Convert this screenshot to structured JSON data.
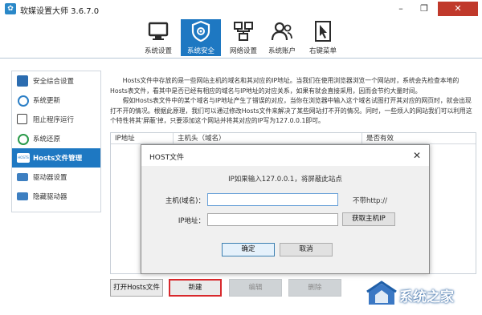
{
  "window": {
    "title": "软媒设置大师 3.6.7.0",
    "controls": {
      "minimize": "–",
      "maximize": "❐",
      "close": "✕"
    }
  },
  "toolbar": {
    "items": [
      {
        "label": "系统设置",
        "icon": "computer-icon",
        "active": false
      },
      {
        "label": "系统安全",
        "icon": "shield-icon",
        "active": true
      },
      {
        "label": "网络设置",
        "icon": "network-icon",
        "active": false
      },
      {
        "label": "系统账户",
        "icon": "users-icon",
        "active": false
      },
      {
        "label": "右键菜单",
        "icon": "cursor-icon",
        "active": false
      }
    ]
  },
  "sidebar": {
    "items": [
      {
        "label": "安全综合设置",
        "icon": "shield-icon",
        "active": false
      },
      {
        "label": "系统更新",
        "icon": "refresh-icon",
        "active": false
      },
      {
        "label": "阻止程序运行",
        "icon": "block-icon",
        "active": false
      },
      {
        "label": "系统还原",
        "icon": "restore-icon",
        "active": false
      },
      {
        "label": "Hosts文件管理",
        "icon": "hosts-icon",
        "active": true
      },
      {
        "label": "驱动器设置",
        "icon": "drive-icon",
        "active": false
      },
      {
        "label": "隐藏驱动器",
        "icon": "hidden-drive-icon",
        "active": false
      }
    ]
  },
  "description": {
    "p1": "Hosts文件中存放的是一些网站主机的域名和其对应的IP地址。当我们在使用浏览器浏览一个网站时，系统会先检查本地的Hosts表文件，看其中是否已经有相应的域名与IP地址的对应关系，如果有就会直接采用，因而会节约大量时间。",
    "p2": "假如Hosts表文件中的某个域名与IP地址产生了错误的对应，当你在浏览器中输入这个域名试图打开其对应的网页时，就会出现打不开的情况。根据此原理，我们可以通过修改Hosts文件来解决了某些网站打不开的情况。同时，一些烦人的网站我们可以利用这个特性将其'屏蔽'掉，只要添加这个网站并将其对应的IP写为127.0.0.1即可。"
  },
  "table": {
    "columns": [
      "IP地址",
      "主机头（域名）",
      "是否有效"
    ]
  },
  "dialog": {
    "title": "HOST文件",
    "close": "✕",
    "hint": "IP如果输入127.0.0.1，将屏蔽此站点",
    "host_label": "主机(域名)：",
    "host_value": "",
    "host_note": "不带http://",
    "ip_label": "IP地址：",
    "ip_value": "",
    "fetch_button": "获取主机IP",
    "ok_button": "确定",
    "cancel_button": "取消"
  },
  "buttons": {
    "open_hosts": "打开Hosts文件",
    "new": "新建",
    "edit": "编辑",
    "delete": "删除"
  },
  "watermark": {
    "text": "系统之家"
  },
  "colors": {
    "accent": "#1e78c2",
    "highlight_border": "#d8282c",
    "close": "#c0392b"
  }
}
